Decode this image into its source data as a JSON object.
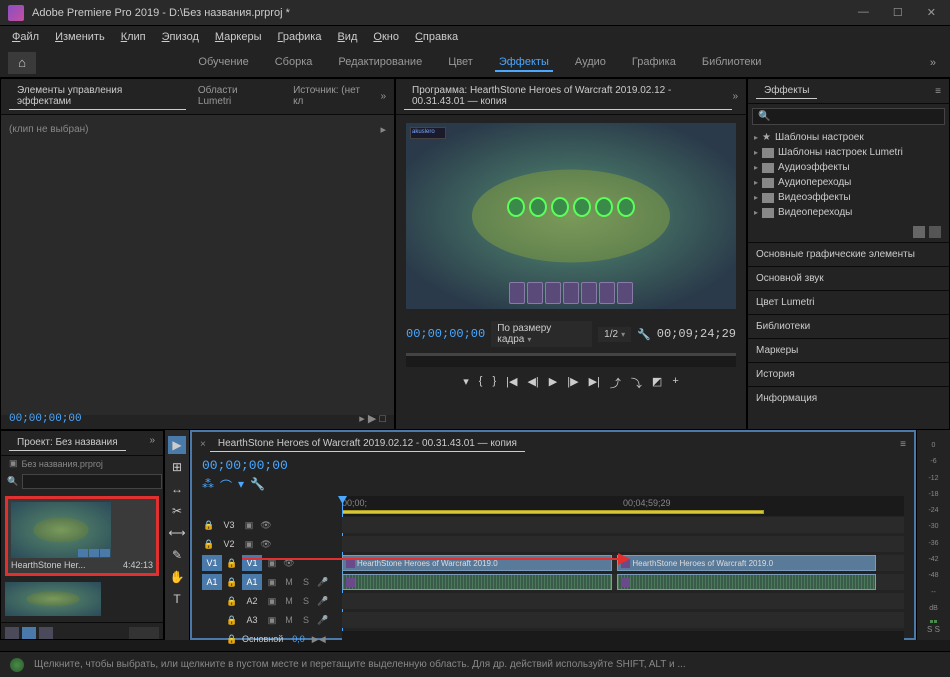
{
  "titlebar": {
    "title": "Adobe Premiere Pro 2019 - D:\\Без названия.prproj *"
  },
  "menubar": {
    "items": [
      "Файл",
      "Изменить",
      "Клип",
      "Эпизод",
      "Маркеры",
      "Графика",
      "Вид",
      "Окно",
      "Справка"
    ]
  },
  "workspace": {
    "tabs": [
      "Обучение",
      "Сборка",
      "Редактирование",
      "Цвет",
      "Эффекты",
      "Аудио",
      "Графика",
      "Библиотеки"
    ],
    "active": "Эффекты"
  },
  "effects_controls": {
    "tabs": [
      "Элементы управления эффектами",
      "Области Lumetri",
      "Источник: (нет кл"
    ],
    "active": "Элементы управления эффектами",
    "clip_text": "(клип не выбран)"
  },
  "program": {
    "title": "Программа: HearthStone  Heroes of Warcraft 2019.02.12 - 00.31.43.01 — копия",
    "timecode_left": "00;00;00;00",
    "fit_label": "По размеру кадра",
    "resolution": "1/2",
    "timecode_right": "00;09;24;29",
    "game_tag": "akuslero"
  },
  "effects_panel": {
    "title": "Эффекты",
    "search_placeholder": "",
    "items": [
      "Шаблоны настроек",
      "Шаблоны настроек Lumetri",
      "Аудиоэффекты",
      "Аудиопереходы",
      "Видеоэффекты",
      "Видеопереходы"
    ]
  },
  "side_panels": [
    "Основные графические элементы",
    "Основной звук",
    "Цвет Lumetri",
    "Библиотеки",
    "Маркеры",
    "История",
    "Информация"
  ],
  "project": {
    "title": "Проект: Без названия",
    "bin": "Без названия.prproj",
    "clip_name": "HearthStone  Her...",
    "clip_duration": "4:42:13"
  },
  "timeline": {
    "sequence_name": "HearthStone  Heroes of Warcraft 2019.02.12 - 00.31.43.01 — копия",
    "timecode": "00;00;00;00",
    "ruler_ticks": [
      "00;00;",
      "00;04;59;29"
    ],
    "tracks_v": [
      "V3",
      "V2",
      "V1"
    ],
    "tracks_a": [
      "A1",
      "A2",
      "A3"
    ],
    "master_label": "Основной",
    "master_value": "0,0",
    "clip1_name": "HearthStone  Heroes of Warcraft 2019.0",
    "clip2_name": "HearthStone  Heroes of Warcraft 2019.0"
  },
  "meters": {
    "scale": [
      "0",
      "-6",
      "-12",
      "-18",
      "-24",
      "-30",
      "-36",
      "-42",
      "-48",
      "--",
      "dB"
    ],
    "letters": "S  S"
  },
  "statusbar": {
    "text": "Щелкните, чтобы выбрать, или щелкните в пустом месте и перетащите выделенную область. Для др. действий используйте SHIFT, ALT и ..."
  }
}
